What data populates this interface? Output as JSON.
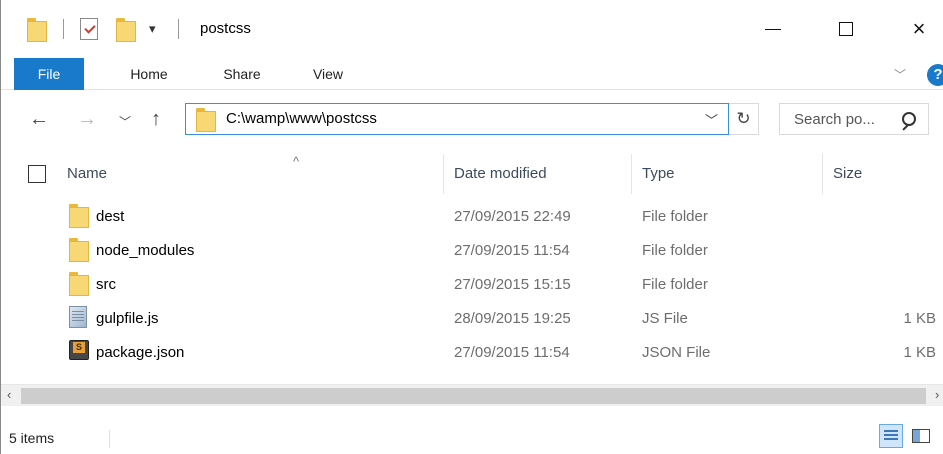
{
  "window": {
    "title": "postcss",
    "controls": {
      "minimize": "minimize",
      "maximize": "maximize",
      "close": "×"
    }
  },
  "ribbon": {
    "tabs": [
      {
        "label": "File",
        "active": true
      },
      {
        "label": "Home"
      },
      {
        "label": "Share"
      },
      {
        "label": "View"
      }
    ],
    "accent_color": "#1979ca"
  },
  "navigation": {
    "address": "C:\\wamp\\www\\postcss",
    "search_placeholder": "Search po..."
  },
  "columns": [
    "Name",
    "Date modified",
    "Type",
    "Size"
  ],
  "files": [
    {
      "name": "dest",
      "date": "27/09/2015 22:49",
      "type": "File folder",
      "size": "",
      "icon": "folder-icon"
    },
    {
      "name": "node_modules",
      "date": "27/09/2015 11:54",
      "type": "File folder",
      "size": "",
      "icon": "folder-icon"
    },
    {
      "name": "src",
      "date": "27/09/2015 15:15",
      "type": "File folder",
      "size": "",
      "icon": "folder-icon"
    },
    {
      "name": "gulpfile.js",
      "date": "28/09/2015 19:25",
      "type": "JS File",
      "size": "1 KB",
      "icon": "js-file-icon"
    },
    {
      "name": "package.json",
      "date": "27/09/2015 11:54",
      "type": "JSON File",
      "size": "1 KB",
      "icon": "json-file-icon"
    }
  ],
  "status": {
    "items_count": "5 items"
  }
}
